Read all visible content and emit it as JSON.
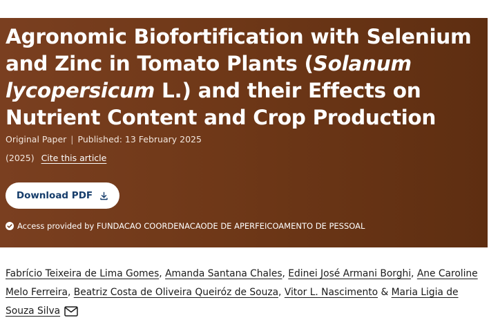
{
  "article": {
    "title_part1": "Agronomic Biofortification with Selenium and Zinc in Tomato Plants (",
    "title_italic": "Solanum lycopersicum",
    "title_part2": " L.) and their Effects on Nutrient Content and Crop Production",
    "type": "Original Paper",
    "published": "Published: 13 February 2025",
    "year": "(2025)",
    "cite_label": "Cite this article",
    "download_label": "Download PDF",
    "access_text": "Access provided by FUNDACAO COORDENACAODE DE APERFEICOAMENTO DE PESSOAL"
  },
  "authors": [
    "Fabrício Teixeira de Lima Gomes",
    "Amanda Santana Chales",
    "Edinei José Armani Borghi",
    "Ane Caroline Melo Ferreira",
    "Beatriz Costa de Oliveira Queiróz de Souza",
    "Vitor L. Nascimento",
    "Maria Ligia de Souza Silva"
  ],
  "author_separator": ", ",
  "author_conjunction": " & ",
  "colors": {
    "hero_background": "#6f3818",
    "button_text": "#163d6b"
  },
  "icons": {
    "download": "download-icon",
    "access": "check-circle-icon",
    "contact": "mail-icon"
  }
}
